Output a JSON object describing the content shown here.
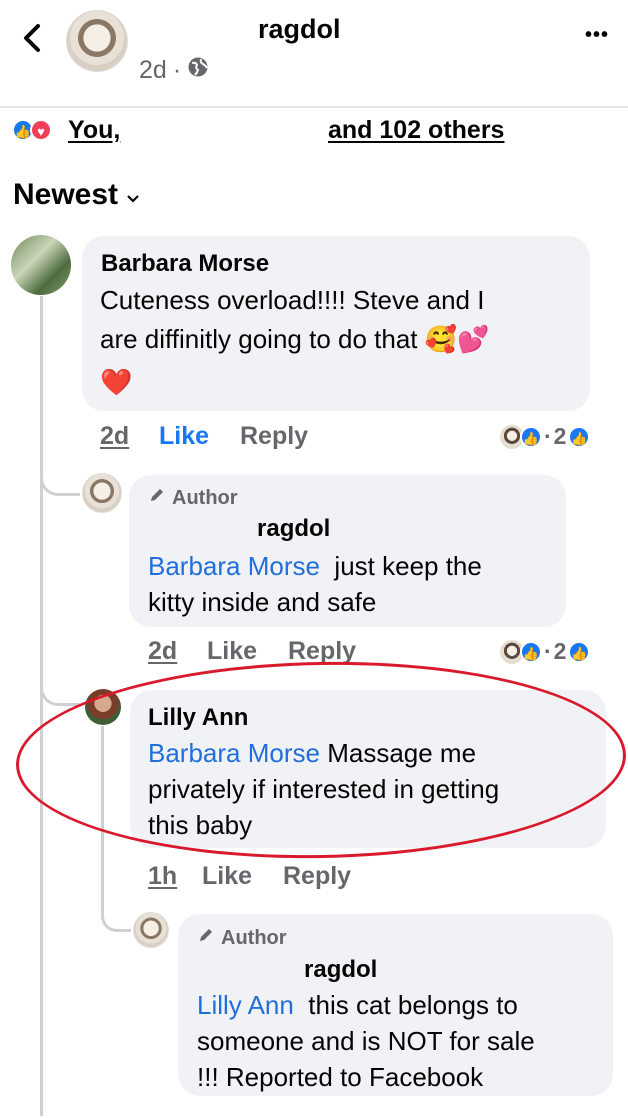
{
  "header": {
    "page_name": "ragdol",
    "time": "2d",
    "dot": "·",
    "more": "•••"
  },
  "reactions": {
    "you": "You,",
    "others": "and 102 others"
  },
  "sort": {
    "label": "Newest",
    "chevron": "⌄"
  },
  "comments": [
    {
      "name": "Barbara Morse",
      "line1": "Cuteness overload!!!! Steve and I",
      "line2": "are diffinitly going to do that 🥰💕",
      "line3": "❤️",
      "time": "2d",
      "like": "Like",
      "reply": "Reply",
      "count": "2",
      "count2": "2"
    },
    {
      "badge": "Author",
      "name": "ragdol",
      "mention": "Barbara Morse",
      "line1_rest": "just keep the",
      "line2": "kitty inside and safe",
      "time": "2d",
      "like": "Like",
      "reply": "Reply",
      "count": "2"
    },
    {
      "name": "Lilly Ann",
      "mention": "Barbara Morse",
      "line1_rest": "Massage me",
      "line2": "privately if interested in getting",
      "line3": "this baby",
      "time": "1h",
      "like": "Like",
      "reply": "Reply"
    },
    {
      "badge": "Author",
      "name": "ragdol",
      "mention": "Lilly Ann",
      "line1_rest": "this cat belongs to",
      "line2": "someone and is NOT for sale",
      "line3": "!!!  Reported to Facebook"
    }
  ],
  "colors": {
    "link_blue": "#216fdb",
    "like_blue": "#1877f2",
    "bubble_gray": "#f0f2f5",
    "annotation_red": "#d9192c"
  }
}
